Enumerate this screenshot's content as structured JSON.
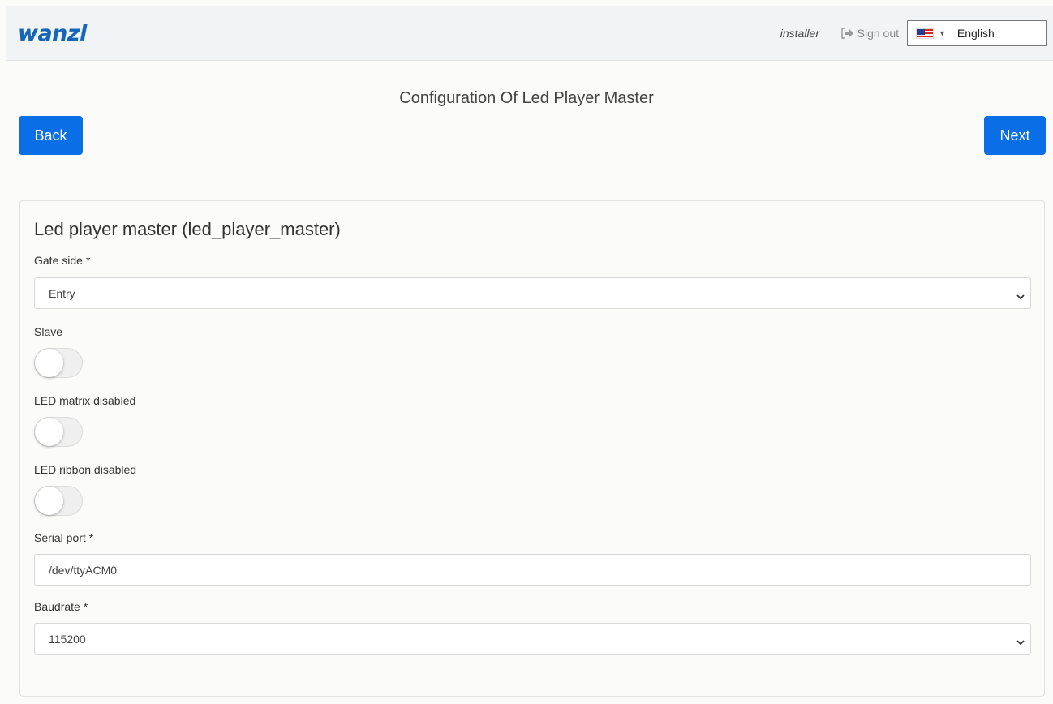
{
  "header": {
    "logo": "wanzl",
    "user": "installer",
    "signout_label": "Sign out",
    "language": "English"
  },
  "page": {
    "title": "Configuration Of Led Player Master",
    "back_label": "Back",
    "next_label": "Next"
  },
  "form": {
    "title": "Led player master (led_player_master)",
    "gate_side": {
      "label": "Gate side *",
      "value": "Entry"
    },
    "slave": {
      "label": "Slave",
      "enabled": false
    },
    "led_matrix_disabled": {
      "label": "LED matrix disabled",
      "enabled": false
    },
    "led_ribbon_disabled": {
      "label": "LED ribbon disabled",
      "enabled": false
    },
    "serial_port": {
      "label": "Serial port *",
      "value": "/dev/ttyACM0"
    },
    "baudrate": {
      "label": "Baudrate *",
      "value": "115200"
    }
  },
  "colors": {
    "primary": "#0a6fe6",
    "logo": "#1566b8"
  }
}
